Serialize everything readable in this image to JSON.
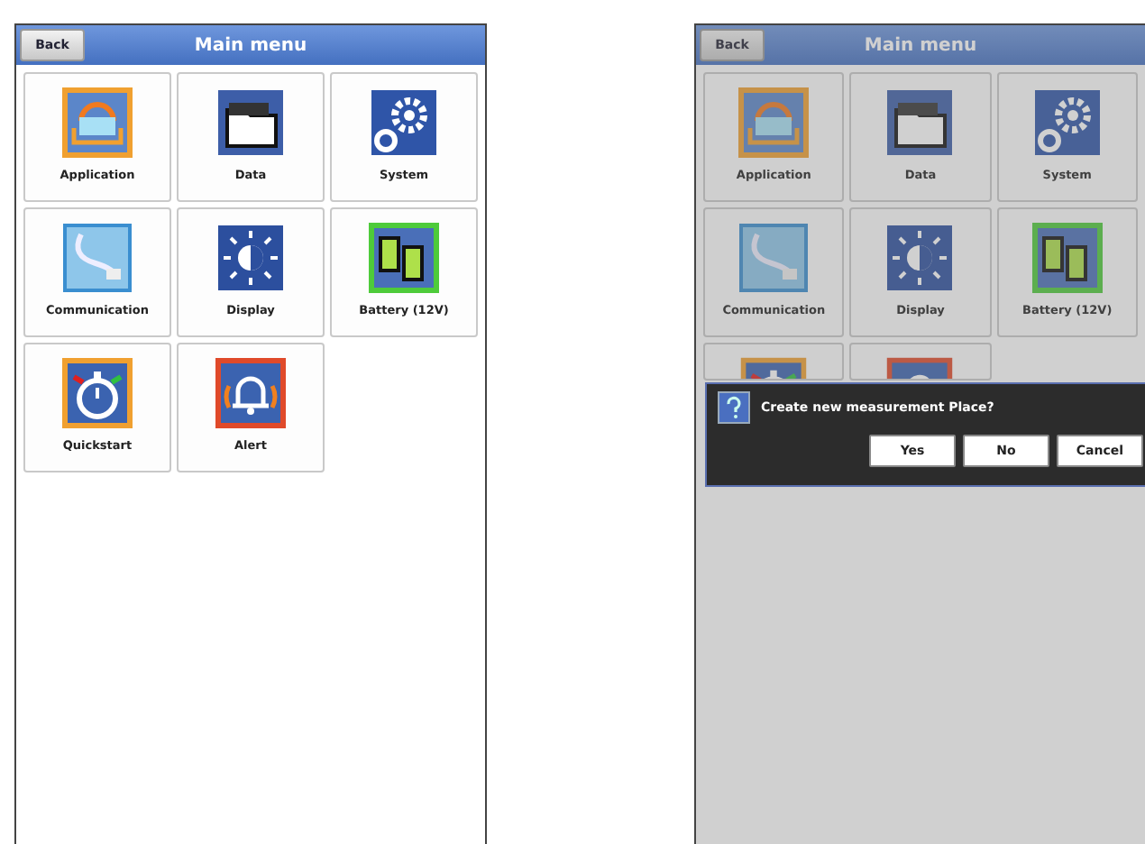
{
  "screens": [
    {
      "header": {
        "back": "Back",
        "title": "Main menu"
      },
      "dimmed": false,
      "items": [
        {
          "kind": "application",
          "label": "Application"
        },
        {
          "kind": "data",
          "label": "Data"
        },
        {
          "kind": "system",
          "label": "System"
        },
        {
          "kind": "communication",
          "label": "Communication"
        },
        {
          "kind": "display",
          "label": "Display"
        },
        {
          "kind": "battery",
          "label": "Battery (12V)"
        },
        {
          "kind": "quickstart",
          "label": "Quickstart"
        },
        {
          "kind": "alert",
          "label": "Alert"
        }
      ]
    },
    {
      "header": {
        "back": "Back",
        "title": "Main menu"
      },
      "dimmed": true,
      "items": [
        {
          "kind": "application",
          "label": "Application"
        },
        {
          "kind": "data",
          "label": "Data"
        },
        {
          "kind": "system",
          "label": "System"
        },
        {
          "kind": "communication",
          "label": "Communication"
        },
        {
          "kind": "display",
          "label": "Display"
        },
        {
          "kind": "battery",
          "label": "Battery (12V)"
        },
        {
          "kind": "quickstart"
        },
        {
          "kind": "alert"
        }
      ],
      "dialog": {
        "message": "Create new measurement Place?",
        "buttons": [
          "Yes",
          "No",
          "Cancel"
        ]
      }
    }
  ]
}
